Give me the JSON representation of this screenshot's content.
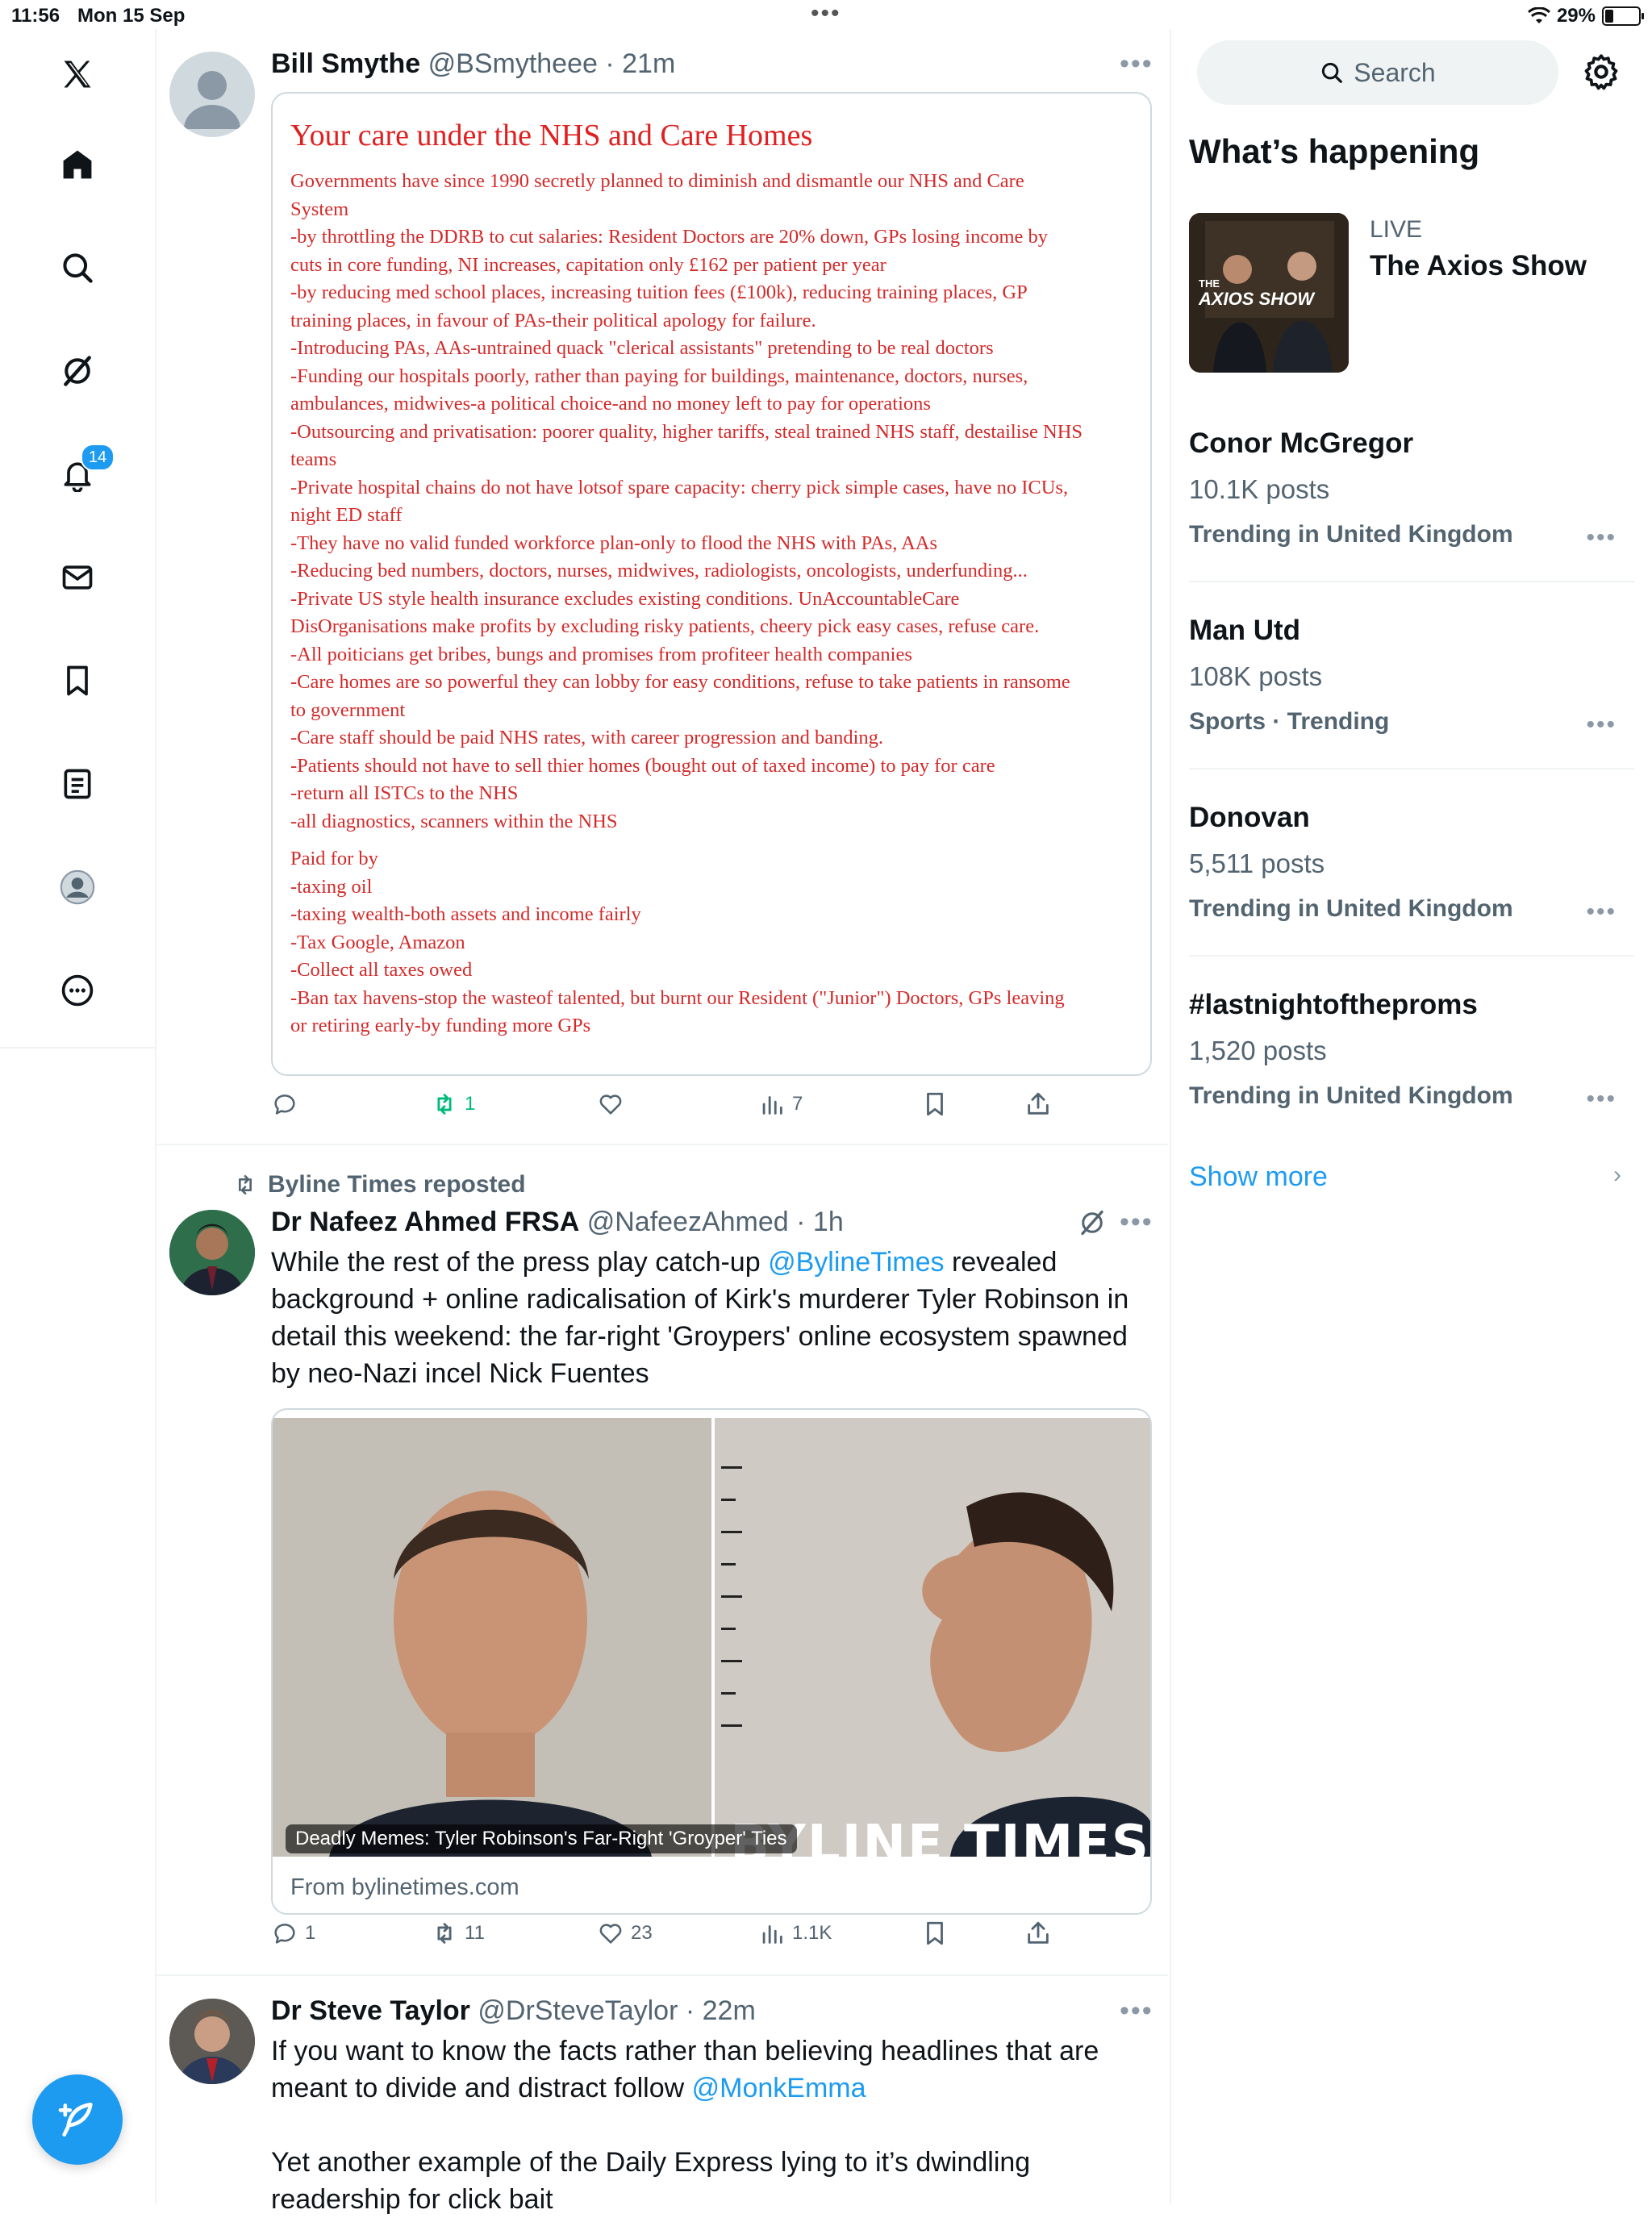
{
  "status_bar": {
    "time": "11:56",
    "date": "Mon 15 Sep",
    "battery": "29%"
  },
  "nav": {
    "notifications_badge": "14"
  },
  "tweets": [
    {
      "name": "Bill Smythe",
      "handle": "@BSmytheee",
      "time": "21m",
      "document": {
        "title": "Your care under the NHS and Care Homes",
        "lines": [
          "Governments have since 1990 secretly planned to diminish and dismantle our NHS and Care",
          "System",
          "-by throttling the DDRB to cut salaries: Resident Doctors are 20% down, GPs losing income by",
          "cuts in core funding, NI increases, capitation only £162 per patient per year",
          "-by reducing med school places, increasing tuition fees (£100k), reducing training places, GP",
          "training places, in favour of PAs-their political apology for failure.",
          "-Introducing PAs, AAs-untrained quack \"clerical assistants\" pretending to be real doctors",
          "-Funding our hospitals poorly, rather than paying for buildings, maintenance, doctors, nurses,",
          "ambulances, midwives-a political choice-and no money left to pay for operations",
          "-Outsourcing and privatisation: poorer quality, higher tariffs, steal trained NHS staff, destailise NHS",
          "teams",
          "-Private hospital chains do not have lotsof spare capacity: cherry pick simple cases, have no ICUs,",
          "night ED staff",
          "-They have no valid funded workforce plan-only to flood the NHS with PAs, AAs",
          "-Reducing bed numbers, doctors, nurses, midwives, radiologists, oncologists, underfunding...",
          "-Private US style health insurance excludes existing conditions. UnAccountableCare",
          "DisOrganisations make profits by excluding risky patients, cheery pick easy cases, refuse care.",
          "-All poiticians get bribes, bungs and promises from profiteer health companies",
          "-Care homes are so powerful they can lobby for easy conditions, refuse to take patients in ransome",
          "to government",
          "-Care staff should be paid NHS rates, with career progression and banding.",
          "-Patients should not have to sell thier homes (bought out of taxed income) to pay for care",
          "-return all ISTCs to the NHS",
          "-all diagnostics, scanners within the NHS"
        ],
        "paid_lines": [
          "Paid for by",
          "-taxing oil",
          "-taxing wealth-both assets and income fairly",
          "-Tax Google, Amazon",
          "-Collect all taxes owed",
          "-Ban tax havens-stop the wasteof talented, but burnt our Resident (\"Junior\") Doctors, GPs leaving",
          "or retiring early-by funding more GPs"
        ]
      },
      "stats": {
        "replies": "",
        "reposts": "1",
        "likes": "",
        "views": "7"
      }
    },
    {
      "repost_label": "Byline Times reposted",
      "name": "Dr Nafeez Ahmed FRSA",
      "handle": "@NafeezAhmed",
      "time": "1h",
      "text_before": "While the rest of the press play catch-up ",
      "mention": "@BylineTimes",
      "text_after": " revealed background + online radicalisation of Kirk's murderer Tyler Robinson in detail this weekend: the far-right 'Groypers' online ecosystem spawned by neo-Nazi incel Nick Fuentes",
      "card": {
        "caption": "Deadly Memes: Tyler Robinson's Far-Right 'Groyper' Ties",
        "watermark": "BYLINE TIMES",
        "domain": "From bylinetimes.com"
      },
      "stats": {
        "replies": "1",
        "reposts": "11",
        "likes": "23",
        "views": "1.1K"
      }
    },
    {
      "name": "Dr Steve Taylor",
      "handle": "@DrSteveTaylor",
      "time": "22m",
      "text_before": "If you want to know the facts rather than believing headlines that are meant to divide and distract follow ",
      "mention": "@MonkEmma",
      "text_2": "Yet another example of the Daily Express lying to it’s dwindling readership for click bait"
    }
  ],
  "sidebar": {
    "search_placeholder": "Search",
    "heading": "What’s happening",
    "live": {
      "label": "LIVE",
      "title": "The Axios Show",
      "thumb_text_1": "THE",
      "thumb_text_2": "AXIOS SHOW"
    },
    "trends": [
      {
        "name": "Conor McGregor",
        "count": "10.1K posts",
        "context": "Trending in United Kingdom"
      },
      {
        "name": "Man Utd",
        "count": "108K posts",
        "context": "Sports · Trending"
      },
      {
        "name": "Donovan",
        "count": "5,511 posts",
        "context": "Trending in United Kingdom"
      },
      {
        "name": "#lastnightoftheproms",
        "count": "1,520 posts",
        "context": "Trending in United Kingdom"
      }
    ],
    "show_more": "Show more"
  },
  "colors": {
    "accent": "#1d9bf0",
    "repost_green": "#00ba7c",
    "doc_red": "#d42a2a"
  }
}
